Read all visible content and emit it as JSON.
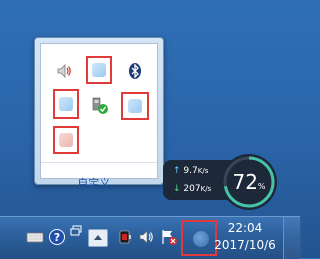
{
  "tray_overflow": {
    "customize_label": "自定义...",
    "icons": [
      "volume-icon",
      "blank-app-icon",
      "bluetooth-icon",
      "blank-app-icon",
      "usb-safely-remove-icon",
      "blank-app-icon",
      "blank-app-icon"
    ]
  },
  "network_widget": {
    "upload_speed": "9.7",
    "upload_unit": "K/s",
    "download_speed": "207",
    "download_unit": "K/s",
    "cpu_percent": "72",
    "cpu_unit": "%",
    "cpu_fraction": 0.72,
    "ring_color": "#45c4a8"
  },
  "taskbar": {
    "clock": {
      "time": "22:04",
      "date": "2017/10/6"
    },
    "icons": [
      "keyboard-icon",
      "help-icon",
      "monitor-icon",
      "show-hidden-icons-button",
      "power-icon",
      "volume-icon",
      "network-flag-icon",
      "blank-app-icon"
    ]
  },
  "highlight_color": "#e03a3a"
}
